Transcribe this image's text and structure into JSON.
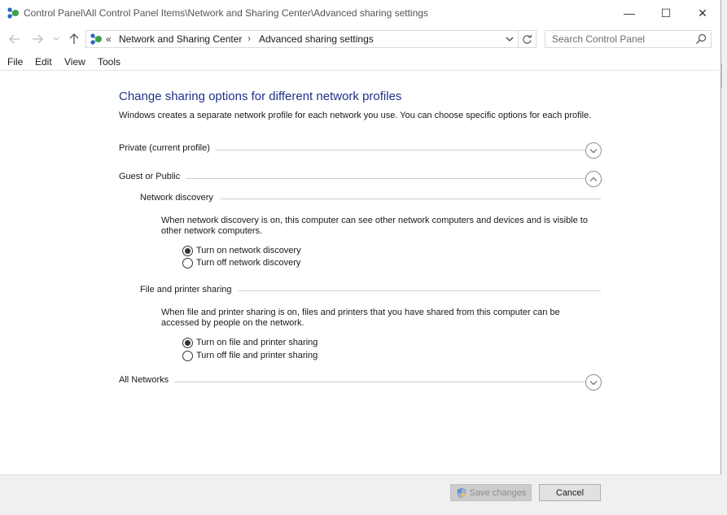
{
  "window": {
    "title": "Control Panel\\All Control Panel Items\\Network and Sharing Center\\Advanced sharing settings",
    "minimize_glyph": "—",
    "maximize_glyph": "☐",
    "close_glyph": "✕"
  },
  "address_bar": {
    "overflow": "«",
    "crumbs": [
      "Network and Sharing Center",
      "Advanced sharing settings"
    ],
    "separator": "›"
  },
  "search": {
    "placeholder": "Search Control Panel"
  },
  "menu": [
    "File",
    "Edit",
    "View",
    "Tools"
  ],
  "content": {
    "heading": "Change sharing options for different network profiles",
    "intro": "Windows creates a separate network profile for each network you use. You can choose specific options for each profile.",
    "profiles": {
      "private": {
        "label": "Private (current profile)",
        "expanded": false
      },
      "guest": {
        "label": "Guest or Public",
        "expanded": true
      },
      "all": {
        "label": "All Networks",
        "expanded": false
      }
    },
    "network_discovery": {
      "title": "Network discovery",
      "description": "When network discovery is on, this computer can see other network computers and devices and is visible to other network computers.",
      "options": [
        {
          "label": "Turn on network discovery",
          "selected": true
        },
        {
          "label": "Turn off network discovery",
          "selected": false
        }
      ]
    },
    "file_sharing": {
      "title": "File and printer sharing",
      "description": "When file and printer sharing is on, files and printers that you have shared from this computer can be accessed by people on the network.",
      "options": [
        {
          "label": "Turn on file and printer sharing",
          "selected": true
        },
        {
          "label": "Turn off file and printer sharing",
          "selected": false
        }
      ]
    }
  },
  "footer": {
    "save_label": "Save changes",
    "save_enabled": false,
    "cancel_label": "Cancel"
  },
  "icons": {
    "title": "network-center-icon",
    "back": "back-arrow-icon",
    "forward": "forward-arrow-icon",
    "recent": "chevron-down-icon",
    "up": "up-arrow-icon",
    "refresh": "refresh-icon",
    "search": "search-icon",
    "shield": "uac-shield-icon"
  },
  "colors": {
    "heading": "#1e3287",
    "accent_green": "#3aa14a",
    "accent_blue": "#2266c8"
  }
}
